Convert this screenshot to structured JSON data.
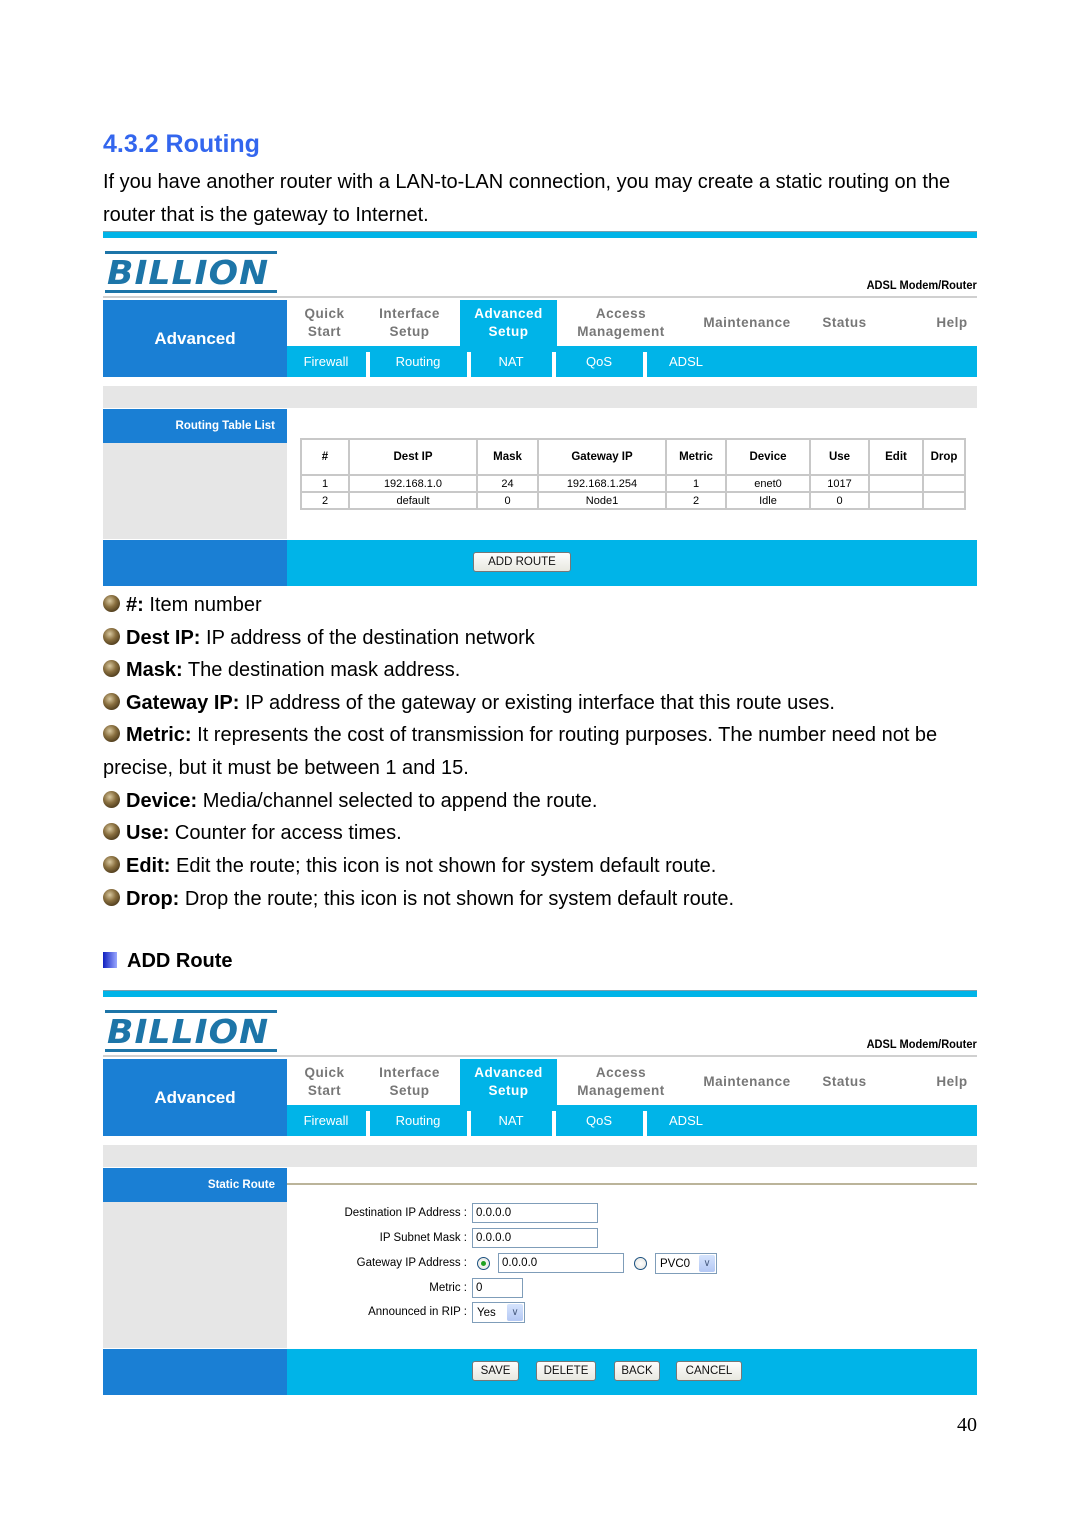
{
  "section": {
    "title": "4.3.2 Routing",
    "intro": "If you have another router with a LAN-to-LAN connection, you may create a static routing on the router that is the gateway to Internet."
  },
  "router_ui": {
    "logo": "BILLION",
    "model": "ADSL Modem/Router",
    "side_title": "Advanced",
    "main_nav": [
      {
        "label": "Quick Start"
      },
      {
        "label": "Interface Setup"
      },
      {
        "label": "Advanced Setup",
        "active": true
      },
      {
        "label": "Access Management"
      },
      {
        "label": "Maintenance"
      },
      {
        "label": "Status"
      },
      {
        "label": "Help"
      }
    ],
    "sub_nav": [
      "Firewall",
      "Routing",
      "NAT",
      "QoS",
      "ADSL"
    ],
    "colors": {
      "dark_blue": "#1a7fd4",
      "light_blue": "#00b4e8",
      "grey": "#e6e6e6"
    }
  },
  "routing_table": {
    "section_label": "Routing Table List",
    "columns": [
      "#",
      "Dest IP",
      "Mask",
      "Gateway IP",
      "Metric",
      "Device",
      "Use",
      "Edit",
      "Drop"
    ],
    "rows": [
      [
        "1",
        "192.168.1.0",
        "24",
        "192.168.1.254",
        "1",
        "enet0",
        "1017",
        "",
        ""
      ],
      [
        "2",
        "default",
        "0",
        "Node1",
        "2",
        "Idle",
        "0",
        "",
        ""
      ]
    ],
    "add_route_button": "ADD ROUTE"
  },
  "bullets": [
    {
      "term": "#:",
      "text": " Item number"
    },
    {
      "term": "Dest IP:",
      "text": " IP address of the destination network"
    },
    {
      "term": "Mask:",
      "text": " The destination mask address."
    },
    {
      "term": "Gateway IP:",
      "text": " IP address of the gateway or existing interface that this route uses."
    },
    {
      "term": "Metric:",
      "text": " It represents the cost of transmission for routing purposes. The number need not be precise, but it must be between 1 and 15."
    },
    {
      "term": "Device:",
      "text": " Media/channel selected to append the route."
    },
    {
      "term": "Use:",
      "text": " Counter for access times."
    },
    {
      "term": "Edit:",
      "text": " Edit the route; this icon is not shown for system default route."
    },
    {
      "term": "Drop:",
      "text": " Drop the route; this icon is not shown for system default route."
    }
  ],
  "add_route": {
    "heading": "ADD Route",
    "section_label": "Static Route",
    "fields": {
      "dest_ip": {
        "label": "Destination IP Address :",
        "value": "0.0.0.0"
      },
      "subnet_mask": {
        "label": "IP Subnet Mask :",
        "value": "0.0.0.0"
      },
      "gateway_ip": {
        "label": "Gateway IP Address :",
        "value": "0.0.0.0",
        "interface": "PVC0",
        "selected": "ip"
      },
      "metric": {
        "label": "Metric :",
        "value": "0"
      },
      "rip": {
        "label": "Announced in RIP :",
        "value": "Yes"
      }
    },
    "buttons": {
      "save": "SAVE",
      "delete": "DELETE",
      "back": "BACK",
      "cancel": "CANCEL"
    }
  },
  "page_number": "40"
}
